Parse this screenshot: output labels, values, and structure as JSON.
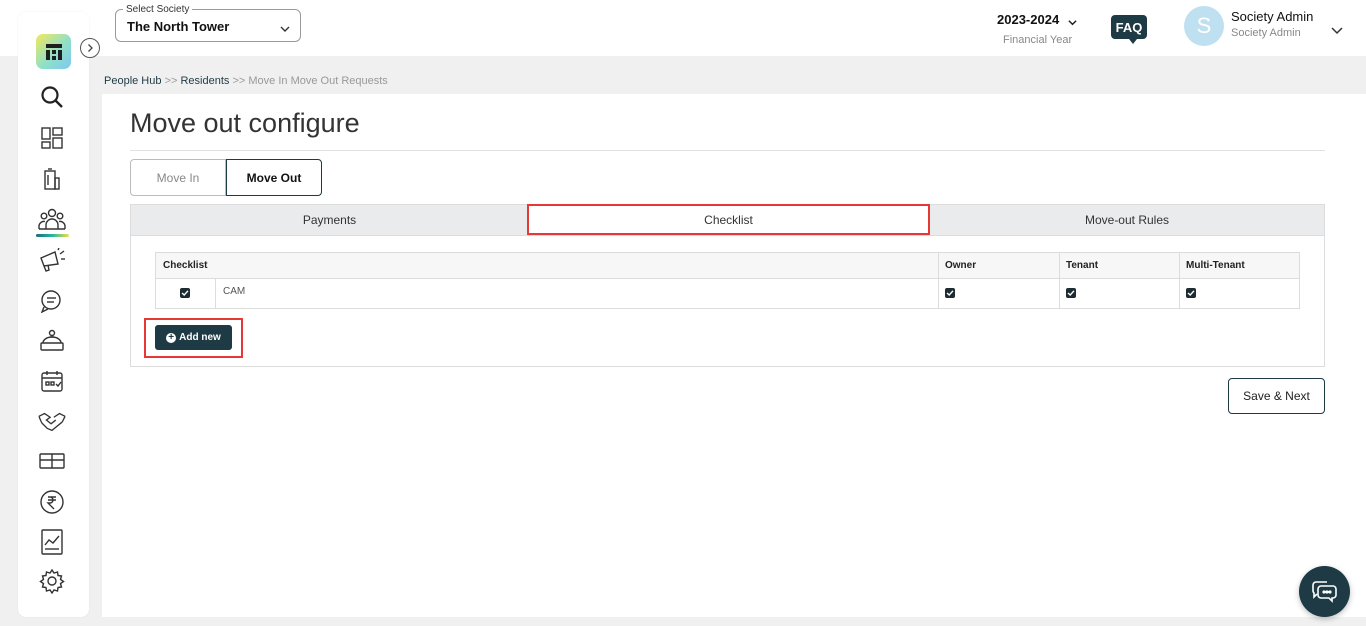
{
  "header": {
    "society_label": "Select Society",
    "society_value": "The North Tower",
    "fy_year": "2023-2024",
    "fy_label": "Financial Year",
    "faq_label": "FAQ",
    "avatar_letter": "S",
    "user_name": "Society Admin",
    "user_role": "Society Admin"
  },
  "sidebar": {
    "items": [
      {
        "icon": "search-icon"
      },
      {
        "icon": "dashboard-icon"
      },
      {
        "icon": "building-icon"
      },
      {
        "icon": "people-icon",
        "active": true
      },
      {
        "icon": "announcement-icon"
      },
      {
        "icon": "chat-icon"
      },
      {
        "icon": "helpdesk-icon"
      },
      {
        "icon": "calendar-icon"
      },
      {
        "icon": "handshake-icon"
      },
      {
        "icon": "parking-icon"
      },
      {
        "icon": "rupee-icon"
      },
      {
        "icon": "report-icon"
      },
      {
        "icon": "gear-icon"
      }
    ]
  },
  "breadcrumb": {
    "item1": "People Hub",
    "sep1": ">>",
    "item2": "Residents",
    "sep2": ">>",
    "item3": "Move In Move Out Requests"
  },
  "main": {
    "title": "Move out configure",
    "mode_tabs": [
      "Move In",
      "Move Out"
    ],
    "sub_tabs": [
      "Payments",
      "Checklist",
      "Move-out Rules"
    ],
    "grid": {
      "headers": [
        "Checklist",
        "Owner",
        "Tenant",
        "Multi-Tenant"
      ],
      "rows": [
        {
          "label": "CAM",
          "selected": true,
          "owner": true,
          "tenant": true,
          "multi_tenant": true
        }
      ]
    },
    "add_new_label": "Add new",
    "save_next_label": "Save & Next"
  },
  "colors": {
    "brand_dark": "#1e3a44",
    "highlight_red": "#e53935"
  }
}
